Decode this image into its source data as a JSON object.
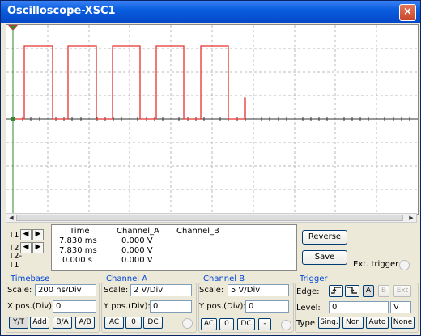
{
  "window": {
    "title": "Oscilloscope-XSC1",
    "close_glyph": "×"
  },
  "readout": {
    "headers": [
      "Time",
      "Channel_A",
      "Channel_B"
    ],
    "rows": [
      {
        "label": "T1",
        "time": "7.830 ms",
        "cha": "0.000 V",
        "chb": ""
      },
      {
        "label": "T2",
        "time": "7.830 ms",
        "cha": "0.000 V",
        "chb": ""
      },
      {
        "label": "T2-T1",
        "time": "0.000 s",
        "cha": "0.000 V",
        "chb": ""
      }
    ]
  },
  "buttons": {
    "reverse": "Reverse",
    "save": "Save",
    "ext_trigger": "Ext. trigger"
  },
  "timebase": {
    "title": "Timebase",
    "scale_label": "Scale:",
    "scale_value": "200 ns/Div",
    "xpos_label": "X pos.(Div):",
    "xpos_value": "0",
    "mode_buttons": [
      "Y/T",
      "Add",
      "B/A",
      "A/B"
    ]
  },
  "channel_a": {
    "title": "Channel A",
    "scale_label": "Scale:",
    "scale_value": "2  V/Div",
    "ypos_label": "Y pos.(Div):",
    "ypos_value": "0",
    "coupling": [
      "AC",
      "0",
      "DC"
    ]
  },
  "channel_b": {
    "title": "Channel B",
    "scale_label": "Scale:",
    "scale_value": "5  V/Div",
    "ypos_label": "Y pos.(Div):",
    "ypos_value": "0",
    "coupling": [
      "AC",
      "0",
      "DC",
      "-"
    ]
  },
  "trigger": {
    "title": "Trigger",
    "edge_label": "Edge:",
    "edge_sources": [
      "A",
      "B",
      "Ext"
    ],
    "level_label": "Level:",
    "level_value": "0",
    "level_unit": "V",
    "type_label": "Type",
    "type_buttons": [
      "Sing.",
      "Nor.",
      "Auto",
      "None"
    ]
  },
  "colors": {
    "trace": "#e8312f",
    "grid": "#b8b8b8",
    "titlebar": "#0a5ee0"
  },
  "trace": {
    "pulse_count": 5,
    "high_level_div": 2.5
  }
}
